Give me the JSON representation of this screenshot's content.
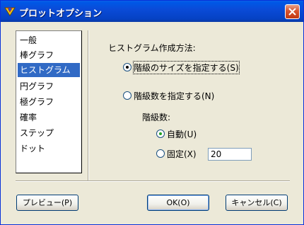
{
  "window": {
    "title": "プロットオプション"
  },
  "sidebar": {
    "items": [
      {
        "label": "一般"
      },
      {
        "label": "棒グラフ"
      },
      {
        "label": "ヒストグラム"
      },
      {
        "label": "円グラフ"
      },
      {
        "label": "極グラフ"
      },
      {
        "label": "確率"
      },
      {
        "label": "ステップ"
      },
      {
        "label": "ドット"
      }
    ],
    "selected": "ヒストグラム"
  },
  "histogram": {
    "method_heading": "ヒストグラム作成方法:",
    "opt_size": "階級のサイズを指定する(S)",
    "opt_count": "階級数を指定する(N)",
    "count_heading": "階級数:",
    "opt_auto": "自動(U)",
    "opt_fixed": "固定(X)",
    "fixed_value": "20",
    "selected_method": "size",
    "selected_count": "auto"
  },
  "buttons": {
    "preview": "プレビュー(P)",
    "ok": "OK(O)",
    "cancel": "キャンセル(C)"
  }
}
